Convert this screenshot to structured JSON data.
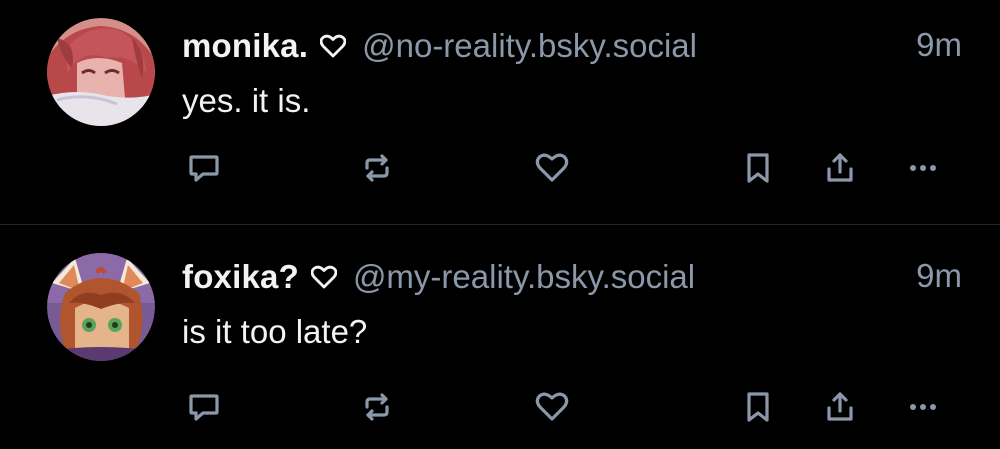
{
  "colors": {
    "background": "#000000",
    "primary_text": "#f1f3f5",
    "secondary_text": "#8b98a9",
    "icon": "#8b98a9",
    "divider": "#1e2530"
  },
  "posts": [
    {
      "display_name": "monika.",
      "handle": "@no-reality.bsky.social",
      "time": "9m",
      "text": "yes. it is.",
      "avatar_icon": "avatar-red-hair",
      "actions": [
        "reply-icon",
        "repost-icon",
        "like-icon",
        "bookmark-icon",
        "share-icon",
        "more-icon"
      ]
    },
    {
      "display_name": "foxika?",
      "handle": "@my-reality.bsky.social",
      "time": "9m",
      "text": "is it too late?",
      "avatar_icon": "avatar-fox-girl",
      "actions": [
        "reply-icon",
        "repost-icon",
        "like-icon",
        "bookmark-icon",
        "share-icon",
        "more-icon"
      ]
    }
  ]
}
